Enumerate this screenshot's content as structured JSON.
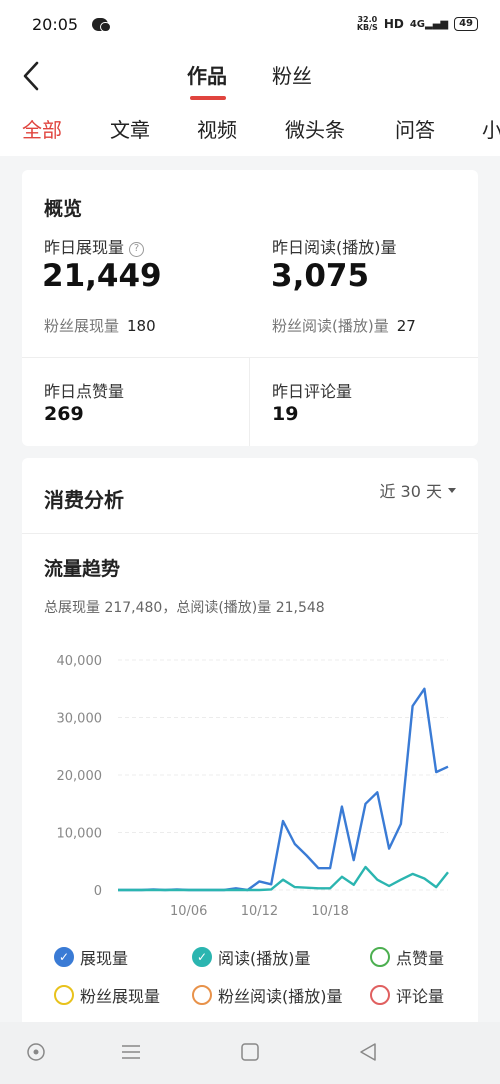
{
  "status_bar": {
    "time": "20:05",
    "net_speed_value": "32.0",
    "net_speed_unit": "KB/S",
    "hd": "HD",
    "signal": "4G",
    "battery": "49"
  },
  "header": {
    "tabs": [
      {
        "label": "作品",
        "active": true
      },
      {
        "label": "粉丝",
        "active": false
      }
    ]
  },
  "categories": [
    {
      "label": "全部",
      "active": true
    },
    {
      "label": "文章",
      "active": false
    },
    {
      "label": "视频",
      "active": false
    },
    {
      "label": "微头条",
      "active": false
    },
    {
      "label": "问答",
      "active": false
    },
    {
      "label": "小",
      "active": false
    }
  ],
  "overview": {
    "title": "概览",
    "impressions_label": "昨日展现量",
    "impressions_value": "21,449",
    "reads_label": "昨日阅读(播放)量",
    "reads_value": "3,075",
    "fan_impressions_label": "粉丝展现量",
    "fan_impressions_value": "180",
    "fan_reads_label": "粉丝阅读(播放)量",
    "fan_reads_value": "27",
    "likes_label": "昨日点赞量",
    "likes_value": "269",
    "comments_label": "昨日评论量",
    "comments_value": "19"
  },
  "analysis": {
    "title": "消费分析",
    "period": "近 30 天",
    "trend_title": "流量趋势",
    "totals": "总展现量 217,480，总阅读(播放)量 21,548"
  },
  "legend": [
    {
      "label": "展现量",
      "color": "#3a7bd5",
      "checked": true
    },
    {
      "label": "阅读(播放)量",
      "color": "#2bb5b0",
      "checked": true
    },
    {
      "label": "点赞量",
      "color": "#4caf50",
      "checked": false
    },
    {
      "label": "粉丝展现量",
      "color": "#e8c21c",
      "checked": false
    },
    {
      "label": "粉丝阅读(播放)量",
      "color": "#e8924a",
      "checked": false
    },
    {
      "label": "评论量",
      "color": "#e06060",
      "checked": false
    }
  ],
  "chart_data": {
    "type": "line",
    "y_ticks": [
      "40,000",
      "30,000",
      "20,000",
      "10,000",
      "0"
    ],
    "ylim": [
      0,
      40000
    ],
    "x_tick_labels": [
      {
        "label": "10/06",
        "index": 6
      },
      {
        "label": "10/12",
        "index": 12
      },
      {
        "label": "10/18",
        "index": 18
      }
    ],
    "series": [
      {
        "name": "展现量",
        "color": "#3a7bd5",
        "values": [
          0,
          0,
          0,
          100,
          0,
          100,
          0,
          0,
          0,
          0,
          300,
          0,
          1500,
          1000,
          12000,
          8000,
          6000,
          3800,
          3800,
          14500,
          5200,
          15000,
          17000,
          7200,
          11500,
          32000,
          35000,
          20500,
          21449
        ]
      },
      {
        "name": "阅读(播放)量",
        "color": "#2bb5b0",
        "values": [
          0,
          0,
          0,
          0,
          0,
          0,
          0,
          0,
          0,
          0,
          0,
          0,
          0,
          100,
          1800,
          500,
          400,
          300,
          300,
          2300,
          900,
          4000,
          1800,
          700,
          1800,
          2800,
          2000,
          500,
          3075
        ]
      }
    ],
    "grid": true
  },
  "nav": {
    "icons": [
      "home-circle-icon",
      "menu-icon",
      "square-icon",
      "back-triangle-icon"
    ]
  }
}
